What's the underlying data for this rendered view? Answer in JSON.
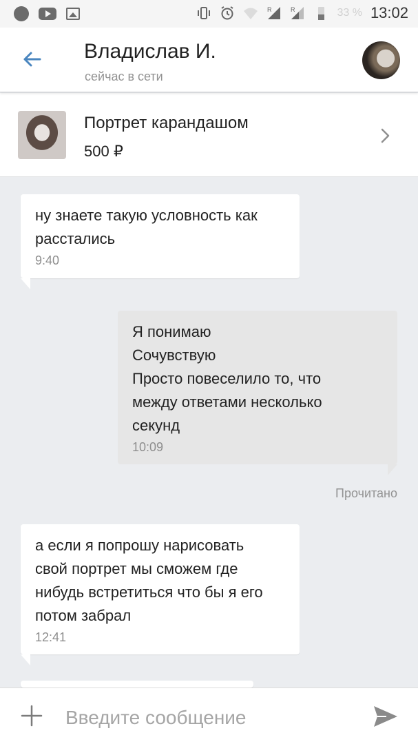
{
  "status_bar": {
    "time": "13:02",
    "battery_text": "33 %",
    "icons": [
      "record-icon",
      "youtube-icon",
      "gallery-icon",
      "vibrate-icon",
      "alarm-icon",
      "wifi-icon",
      "signal-r-icon",
      "signal-r-icon",
      "battery-icon"
    ]
  },
  "header": {
    "name": "Владислав И.",
    "status": "сейчас в сети",
    "back_icon": "arrow-left-icon",
    "avatar": "contact-avatar"
  },
  "product": {
    "title": "Портрет карандашом",
    "price": "500 ₽",
    "icon": "chevron-right-icon"
  },
  "messages": [
    {
      "direction": "incoming",
      "lines": [
        "ну знаете такую условность как",
        "расстались"
      ],
      "time": "9:40"
    },
    {
      "direction": "outgoing",
      "lines": [
        "Я понимаю",
        "Сочувствую",
        "Просто повеселило то, что",
        "между ответами несколько",
        "секунд"
      ],
      "time": "10:09"
    },
    {
      "direction": "incoming",
      "lines": [
        "а если я попрошу нарисовать",
        "свой портрет мы сможем где",
        "нибудь встретиться что бы я его",
        "потом забрал"
      ],
      "time": "12:41"
    }
  ],
  "read_receipt": "Прочитано",
  "composer": {
    "placeholder": "Введите сообщение",
    "attach_icon": "plus-icon",
    "send_icon": "send-icon"
  },
  "colors": {
    "accent": "#4a86bf",
    "incoming_bubble": "#ffffff",
    "outgoing_bubble": "#e6e6e6",
    "background": "#ebedf0"
  }
}
